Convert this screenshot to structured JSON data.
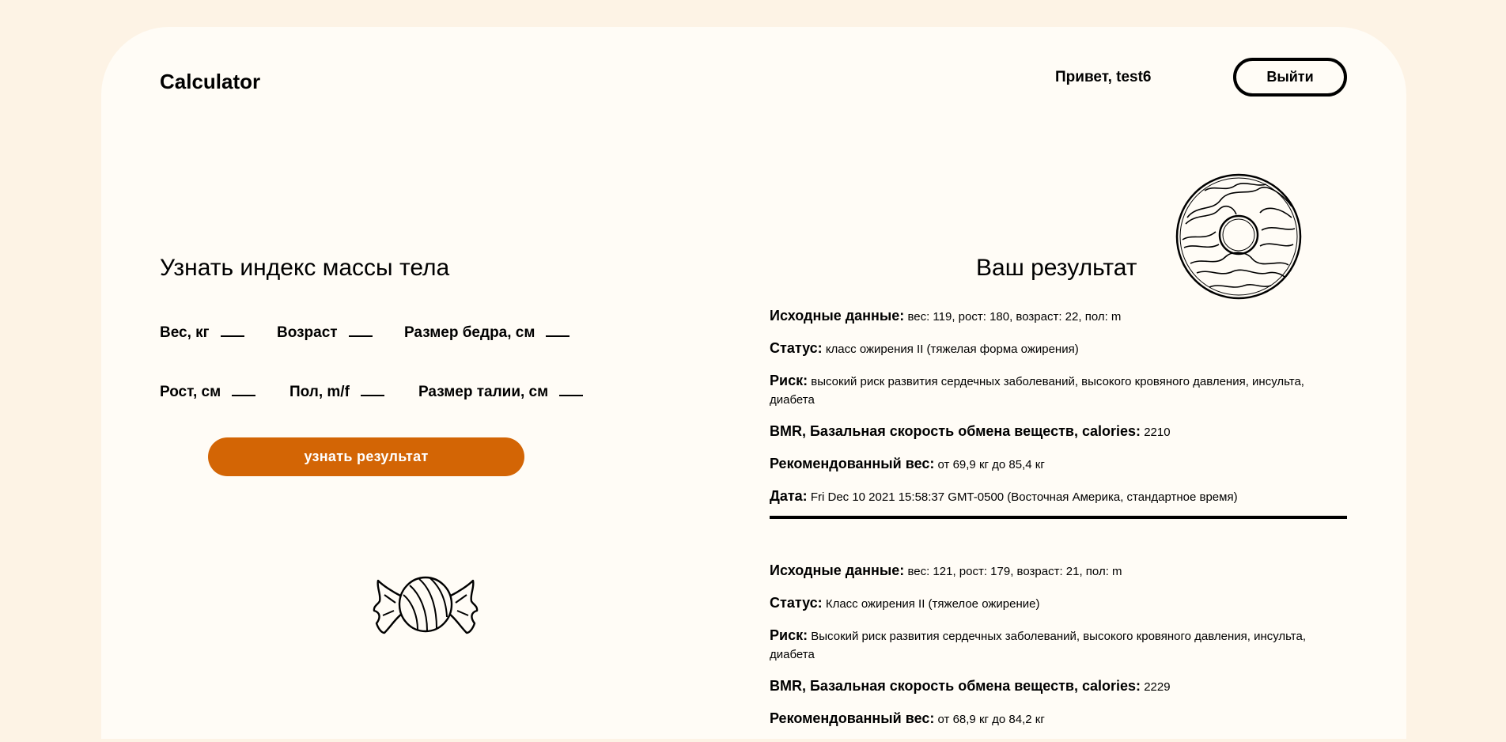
{
  "header": {
    "brand": "Calculator",
    "greeting": "Привет, test6",
    "logout_label": "Выйти"
  },
  "form": {
    "title": "Узнать индекс массы тела",
    "fields": {
      "weight": "Вес, кг",
      "age": "Возраст",
      "hip": "Размер бедра, см",
      "height": "Рост, см",
      "sex": "Пол, m/f",
      "waist": "Размер талии, см"
    },
    "submit_label": "узнать результат"
  },
  "results": {
    "title": "Ваш результат",
    "labels": {
      "input": "Исходные данные:",
      "status": "Статус:",
      "risk": "Риск:",
      "bmr": "BMR, Базальная скорость обмена веществ, calories:",
      "recommended": "Рекомендованный вес:",
      "date": "Дата:"
    },
    "entries": [
      {
        "input": "вес: 119, рост: 180, возраст: 22, пол: m",
        "status": "класс ожирения II (тяжелая форма ожирения)",
        "risk": "высокий риск развития сердечных заболеваний, высокого кровяного давления, инсульта, диабета",
        "bmr": "2210",
        "recommended": "от 69,9 кг до 85,4 кг",
        "date": "Fri Dec 10 2021 15:58:37 GMT-0500 (Восточная Америка, стандартное время)"
      },
      {
        "input": "вес: 121, рост: 179, возраст: 21, пол: m",
        "status": "Класс ожирения II (тяжелое ожирение)",
        "risk": "Высокий риск развития сердечных заболеваний, высокого кровяного давления, инсульта, диабета",
        "bmr": "2229",
        "recommended": "от 68,9 кг до 84,2 кг"
      }
    ]
  },
  "icons": {
    "donut": "donut-illustration",
    "candy": "candy-illustration"
  },
  "colors": {
    "page_background": "#fdf3e5",
    "card_background": "#fffcf6",
    "accent": "#d36505"
  }
}
